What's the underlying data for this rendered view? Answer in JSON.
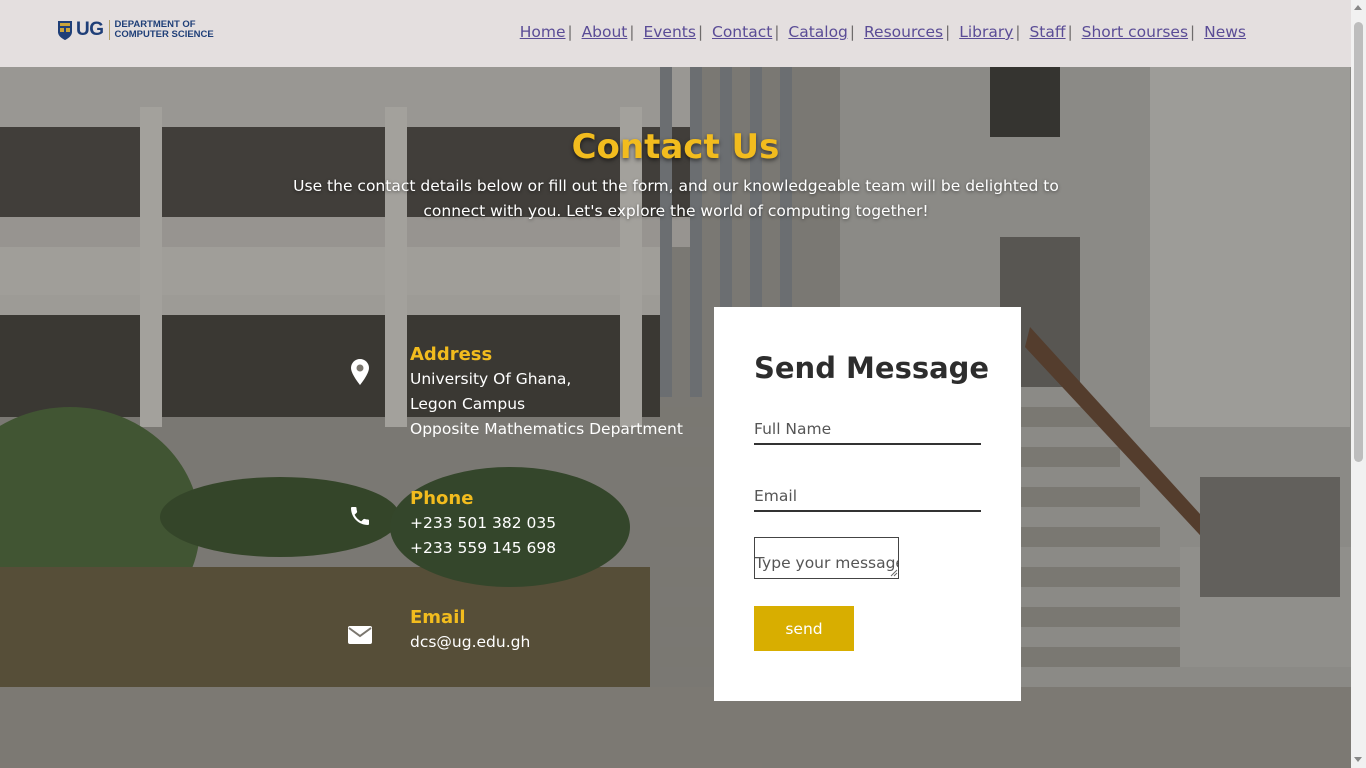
{
  "header": {
    "logo": {
      "ug": "UG",
      "line1": "DEPARTMENT OF",
      "line2": "COMPUTER SCIENCE"
    },
    "nav": [
      {
        "label": "Home",
        "sep": "|"
      },
      {
        "label": "About",
        "sep": "|"
      },
      {
        "label": "Events",
        "sep": "|"
      },
      {
        "label": "Contact",
        "sep": "|"
      },
      {
        "label": "Catalog",
        "sep": "|"
      },
      {
        "label": "Resources",
        "sep": "|"
      },
      {
        "label": "Library",
        "sep": "|"
      },
      {
        "label": "Staff",
        "sep": "|"
      },
      {
        "label": "Short courses",
        "sep": "|"
      },
      {
        "label": "News",
        "sep": ""
      }
    ]
  },
  "hero": {
    "title": "Contact Us",
    "subtitle_line1": "Use the contact details below or fill out the form, and our knowledgeable team will be delighted to",
    "subtitle_line2": "connect with you. Let's explore the world of computing together!"
  },
  "contact": {
    "address": {
      "heading": "Address",
      "lines": [
        "University Of Ghana,",
        "Legon Campus",
        "Opposite Mathematics Department"
      ],
      "icon": "map-marker-icon"
    },
    "phone": {
      "heading": "Phone",
      "lines": [
        "+233 501 382 035",
        "+233 559 145 698"
      ],
      "icon": "phone-icon"
    },
    "email": {
      "heading": "Email",
      "lines": [
        "dcs@ug.edu.gh"
      ],
      "icon": "envelope-icon"
    }
  },
  "form": {
    "title": "Send Message",
    "name_placeholder": "Full Name",
    "email_placeholder": "Email",
    "message_placeholder": "Type your message",
    "send_label": "send"
  },
  "colors": {
    "accent": "#f2bc1e",
    "button": "#d8ae00",
    "nav_link": "#5a4c96",
    "header_bg": "#e4dfdf"
  }
}
